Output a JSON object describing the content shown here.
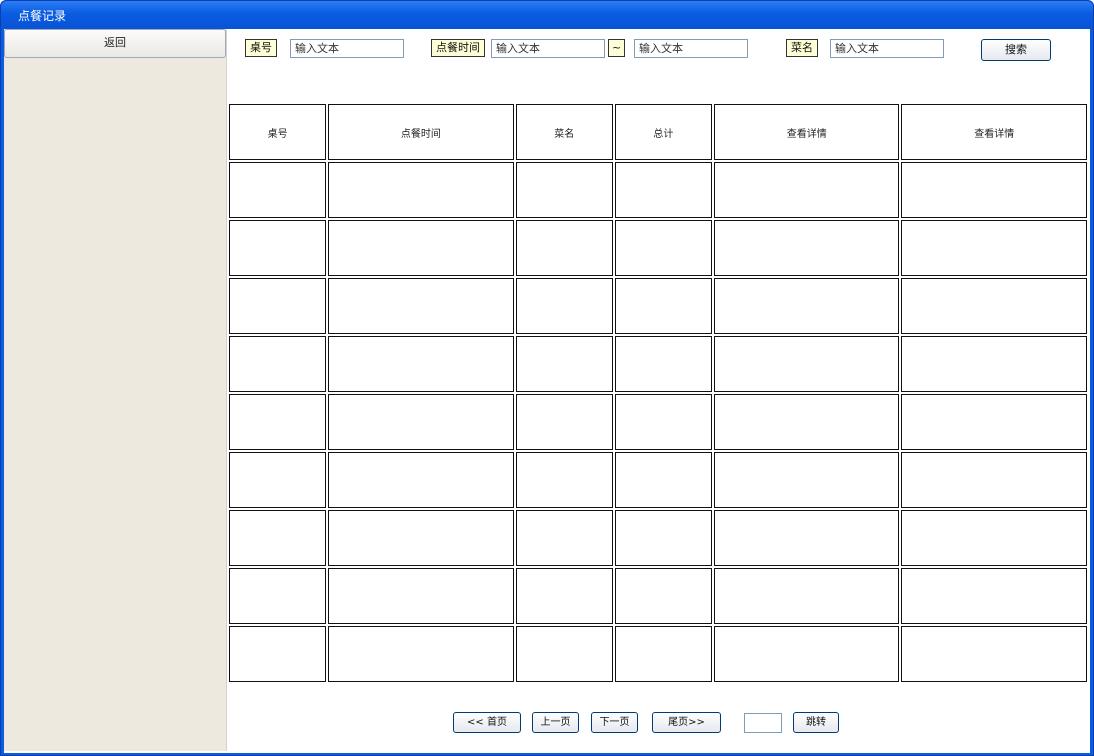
{
  "window": {
    "title": "点餐记录"
  },
  "sidebar": {
    "back_label": "返回"
  },
  "filters": {
    "table_no_label": "桌号",
    "table_no_value": "输入文本",
    "time_label": "点餐时间",
    "time_from_value": "输入文本",
    "range_sep": "~",
    "time_to_value": "输入文本",
    "dish_label": "菜名",
    "dish_value": "输入文本",
    "search_label": "搜索"
  },
  "table": {
    "headers": [
      "桌号",
      "点餐时间",
      "菜名",
      "总计",
      "查看详情",
      "查看详情"
    ],
    "rows": [
      [
        "",
        "",
        "",
        "",
        "",
        ""
      ],
      [
        "",
        "",
        "",
        "",
        "",
        ""
      ],
      [
        "",
        "",
        "",
        "",
        "",
        ""
      ],
      [
        "",
        "",
        "",
        "",
        "",
        ""
      ],
      [
        "",
        "",
        "",
        "",
        "",
        ""
      ],
      [
        "",
        "",
        "",
        "",
        "",
        ""
      ],
      [
        "",
        "",
        "",
        "",
        "",
        ""
      ],
      [
        "",
        "",
        "",
        "",
        "",
        ""
      ],
      [
        "",
        "",
        "",
        "",
        "",
        ""
      ]
    ]
  },
  "pagination": {
    "first": "<< 首页",
    "prev": "上一页",
    "next": "下一页",
    "last": "尾页>>",
    "jump_value": "",
    "jump_label": "跳转"
  }
}
